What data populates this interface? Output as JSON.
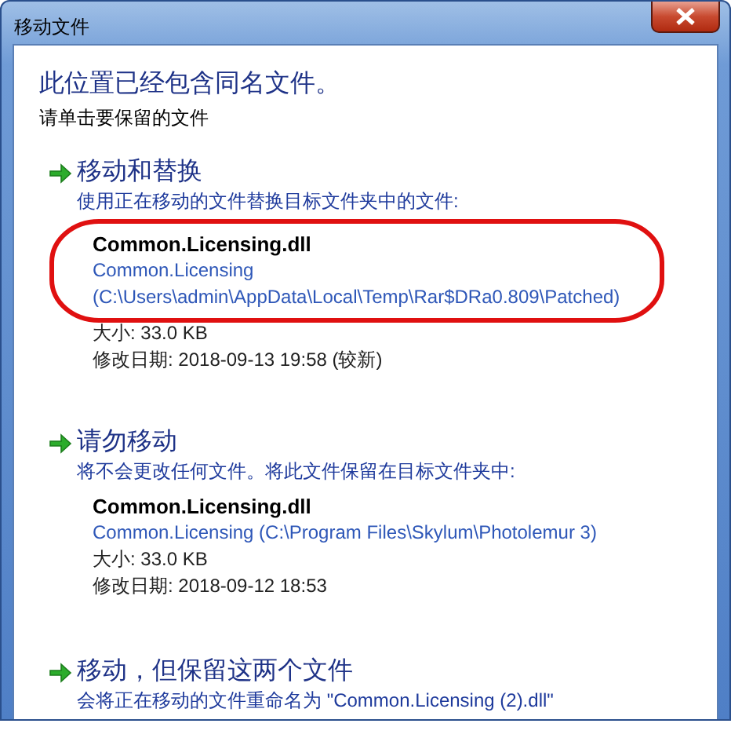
{
  "window": {
    "title": "移动文件"
  },
  "heading": "此位置已经包含同名文件。",
  "instruction": "请单击要保留的文件",
  "options": [
    {
      "title": "移动和替换",
      "highlighted": true,
      "description": "使用正在移动的文件替换目标文件夹中的文件:",
      "file": {
        "name": "Common.Licensing.dll",
        "path": "Common.Licensing (C:\\Users\\admin\\AppData\\Local\\Temp\\Rar$DRa0.809\\Patched)",
        "size": "大小: 33.0 KB",
        "modified": "修改日期: 2018-09-13 19:58 (较新)"
      }
    },
    {
      "title": "请勿移动",
      "highlighted": false,
      "description": "将不会更改任何文件。将此文件保留在目标文件夹中:",
      "file": {
        "name": "Common.Licensing.dll",
        "path": "Common.Licensing (C:\\Program Files\\Skylum\\Photolemur 3)",
        "size": "大小: 33.0 KB",
        "modified": "修改日期: 2018-09-12 18:53"
      }
    },
    {
      "title": "移动，但保留这两个文件",
      "highlighted": false,
      "description": "会将正在移动的文件重命名为 \"Common.Licensing (2).dll\""
    }
  ],
  "annotation": {
    "kind": "ellipse",
    "color": "#e01010"
  }
}
